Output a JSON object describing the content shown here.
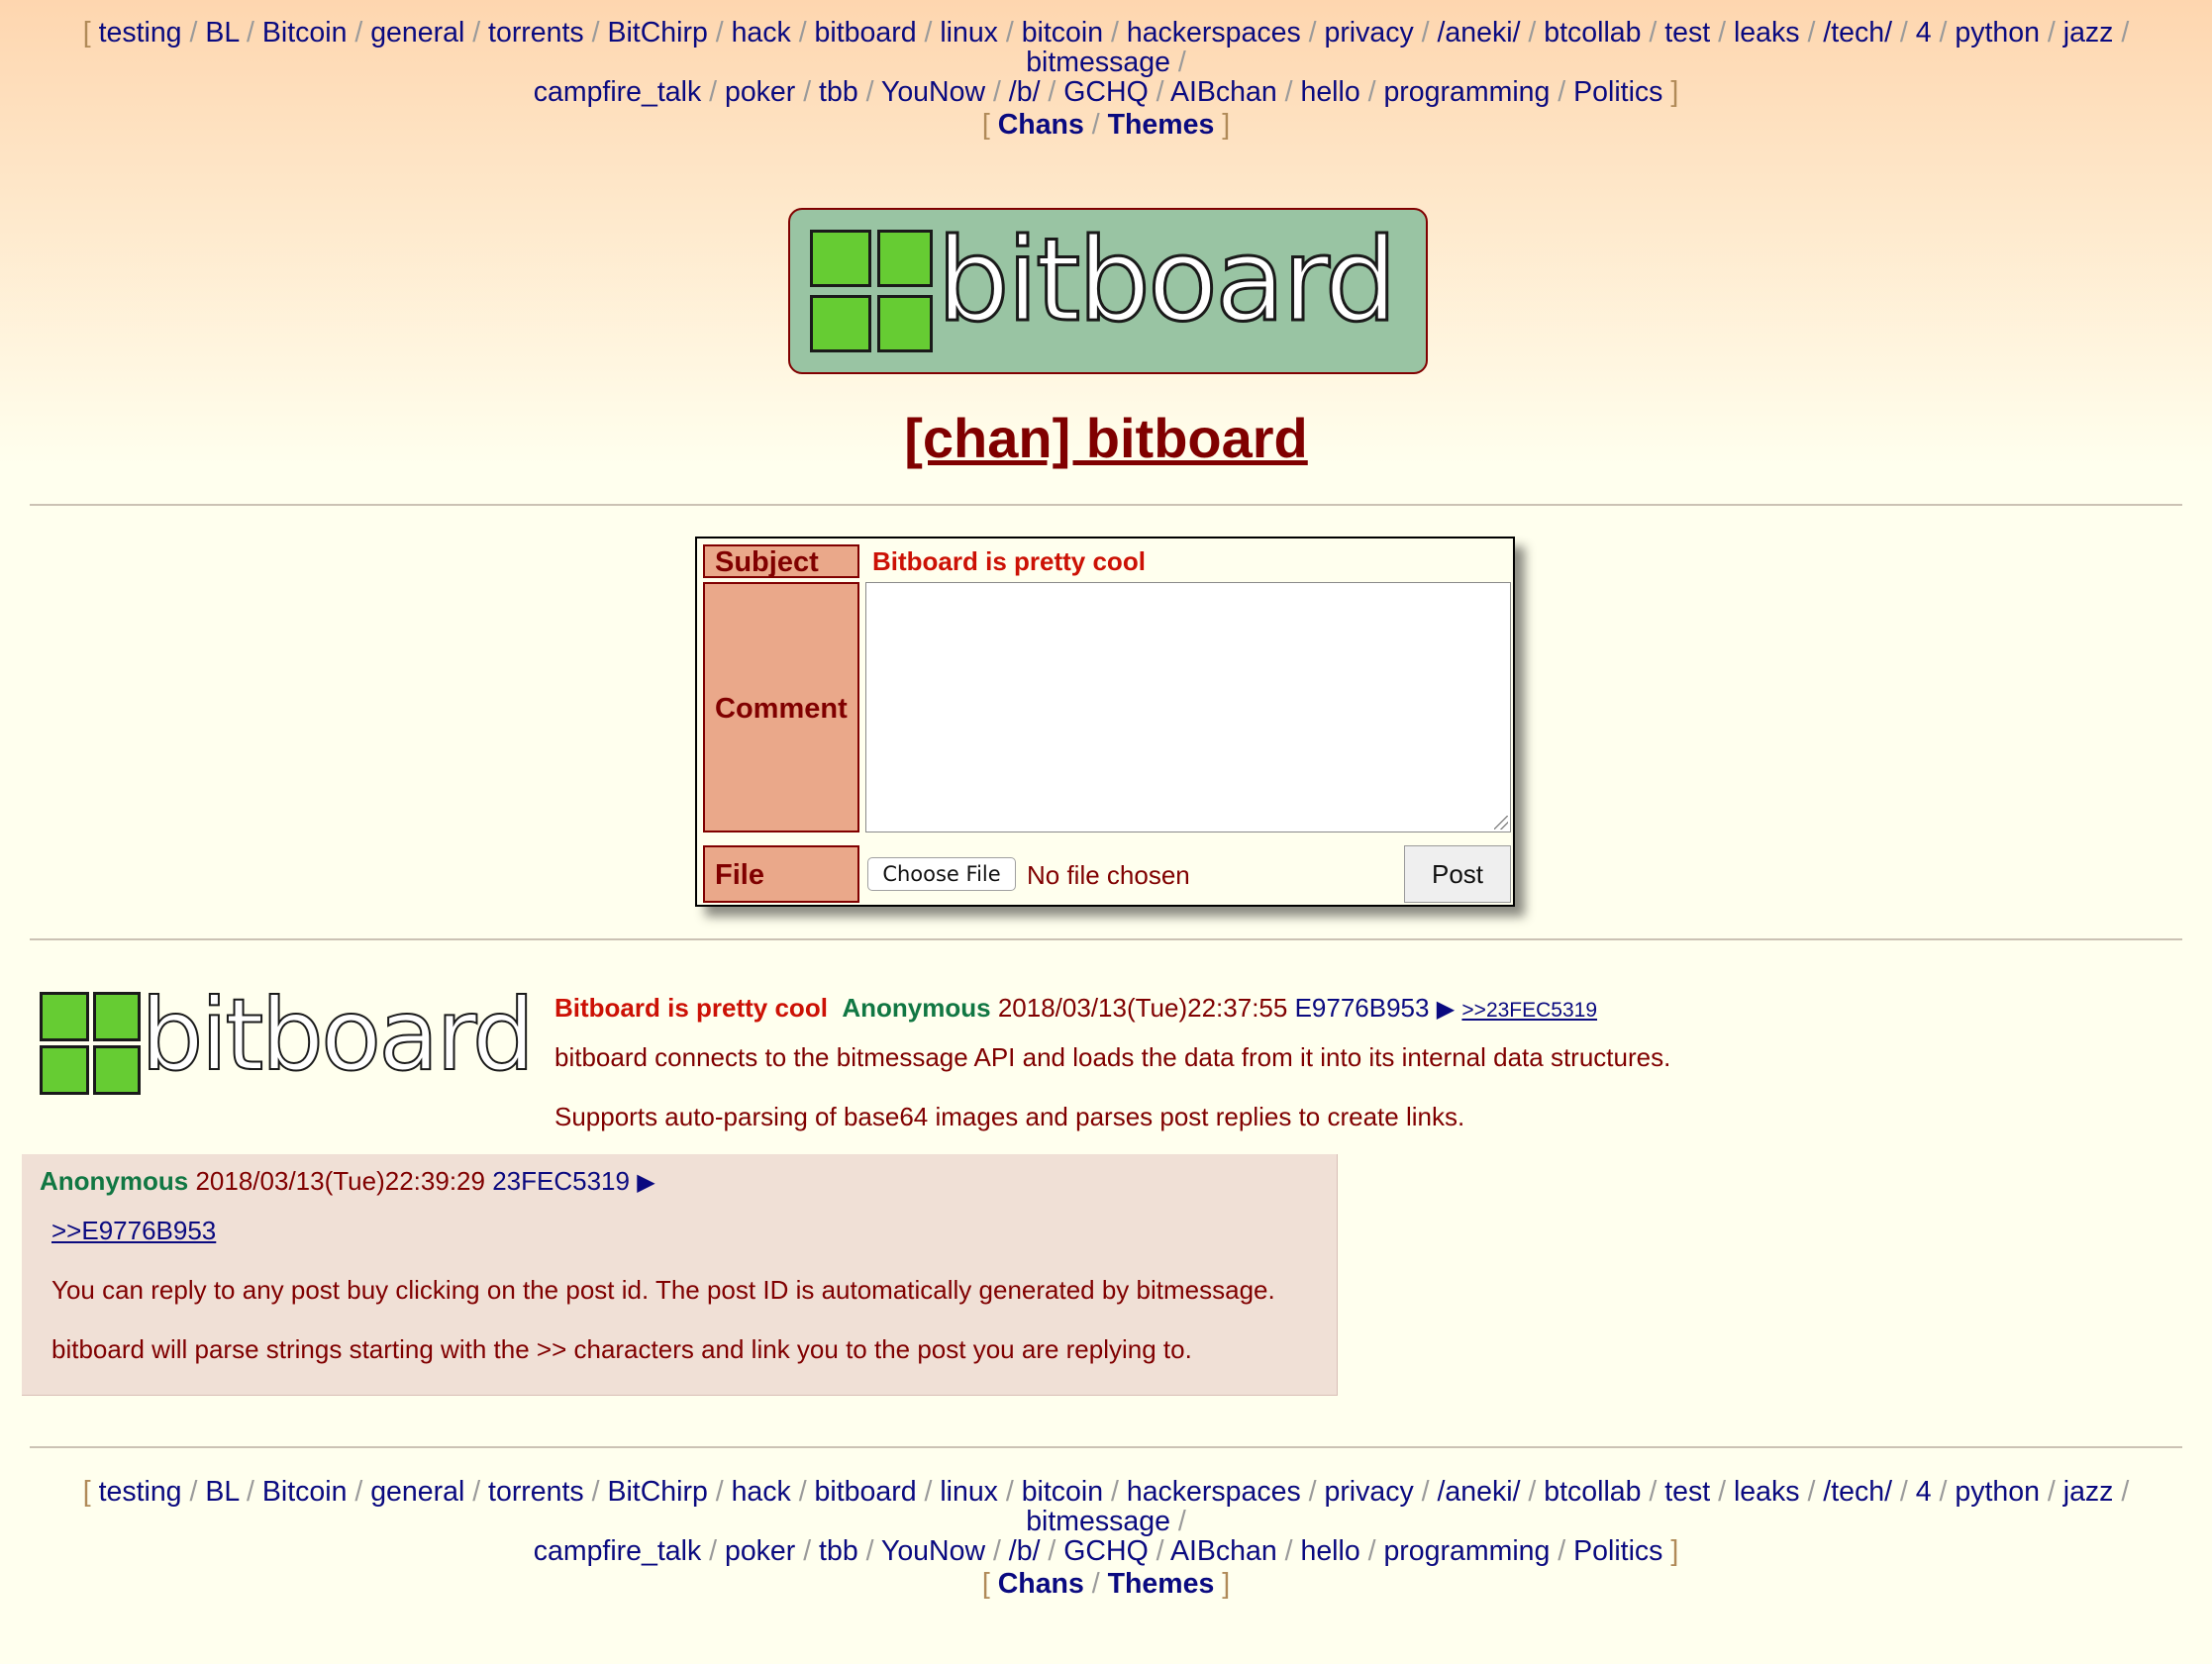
{
  "boardlist": {
    "line1": [
      "testing",
      "BL",
      "Bitcoin",
      "general",
      "torrents",
      "BitChirp",
      "hack",
      "bitboard",
      "linux",
      "bitcoin",
      "hackerspaces",
      "privacy",
      "/aneki/",
      "btcollab",
      "test",
      "leaks",
      "/tech/",
      "4",
      "python",
      "jazz",
      "bitmessage"
    ],
    "line2": [
      "campfire_talk",
      "poker",
      "tbb",
      "YouNow",
      "/b/",
      "GCHQ",
      "AIBchan",
      "hello",
      "programming",
      "Politics"
    ]
  },
  "meta_links": {
    "chans": "Chans",
    "themes": "Themes"
  },
  "brackets": {
    "open": "[",
    "close": "]",
    "sep": "/"
  },
  "logo": {
    "text": "bitboard",
    "square_color": "#66cc33",
    "bg_color": "#99c4a3"
  },
  "board_title": "[chan] bitboard",
  "postform": {
    "subject_label": "Subject",
    "subject_value": "Bitboard is pretty cool",
    "comment_label": "Comment",
    "comment_value": "",
    "file_label": "File",
    "choose_file": "Choose File",
    "file_status": "No file chosen",
    "post_button": "Post"
  },
  "op": {
    "subject": "Bitboard is pretty cool",
    "name": "Anonymous",
    "datetime": "2018/03/13(Tue)22:37:55",
    "post_id": "E9776B953",
    "reply_link": ">>23FEC5319",
    "body": [
      "bitboard connects to the bitmessage API and loads the data from it into its internal data structures.",
      "Supports auto-parsing of base64 images and parses post replies to create links."
    ]
  },
  "reply": {
    "name": "Anonymous",
    "datetime": "2018/03/13(Tue)22:39:29",
    "post_id": "23FEC5319",
    "quote_link": ">>E9776B953",
    "body": [
      "You can reply to any post buy clicking on the post id. The post ID is automatically generated by bitmessage.",
      "bitboard will parse strings starting with the >> characters and link you to the post you are replying to."
    ]
  },
  "colors": {
    "accent": "#800000",
    "link": "#0a0a80",
    "name": "#117743",
    "subject": "#cc1105",
    "reply_bg": "#f0e0d6",
    "label_bg": "#eaa88a"
  }
}
